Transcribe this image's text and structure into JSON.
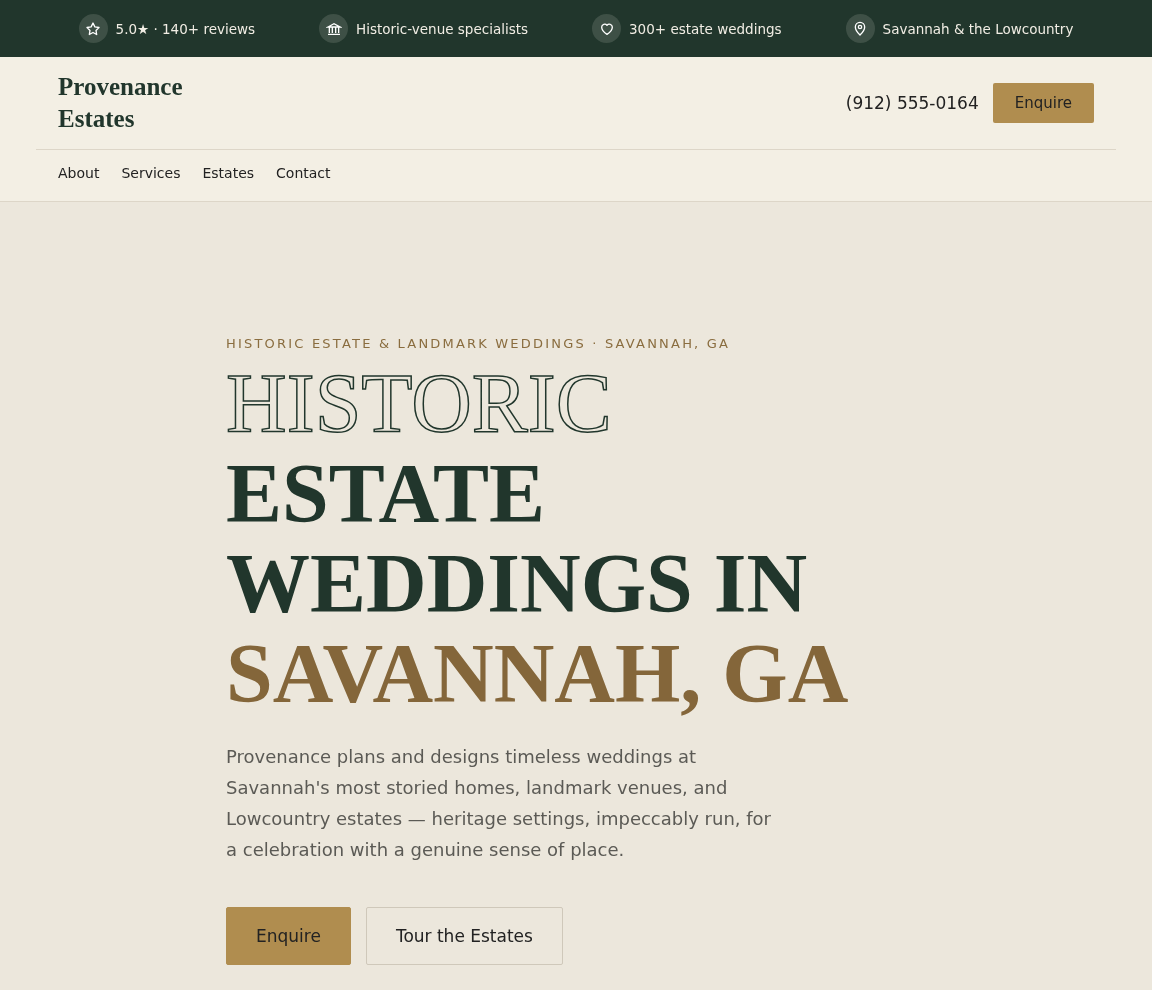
{
  "trust_bar": [
    {
      "kind": "star",
      "text": "5.0★ · 140+ reviews"
    },
    {
      "kind": "landmark",
      "text": "Historic-venue specialists"
    },
    {
      "kind": "heart",
      "text": "300+ estate weddings"
    },
    {
      "kind": "pin",
      "text": "Savannah & the Lowcountry"
    }
  ],
  "header": {
    "logo": "Provenance Estates",
    "phone": "(912) 555-0164",
    "cta": "Enquire"
  },
  "nav": [
    "About",
    "Services",
    "Estates",
    "Contact"
  ],
  "hero": {
    "eyebrow": "HISTORIC ESTATE & LANDMARK WEDDINGS · SAVANNAH, GA",
    "headline": [
      {
        "text": "HISTORIC",
        "kind": "outline"
      },
      {
        "text": "ESTATE WEDDINGS IN",
        "kind": "solid"
      },
      {
        "text": "SAVANNAH, GA",
        "kind": "accent"
      }
    ],
    "body": "Provenance plans and designs timeless weddings at Savannah's most storied homes, landmark venues, and Lowcountry estates — heritage settings, impeccably run, for a celebration with a genuine sense of place.",
    "buttons": [
      {
        "label": "Enquire",
        "kind": "primary"
      },
      {
        "label": "Tour the Estates",
        "kind": "secondary"
      }
    ]
  }
}
